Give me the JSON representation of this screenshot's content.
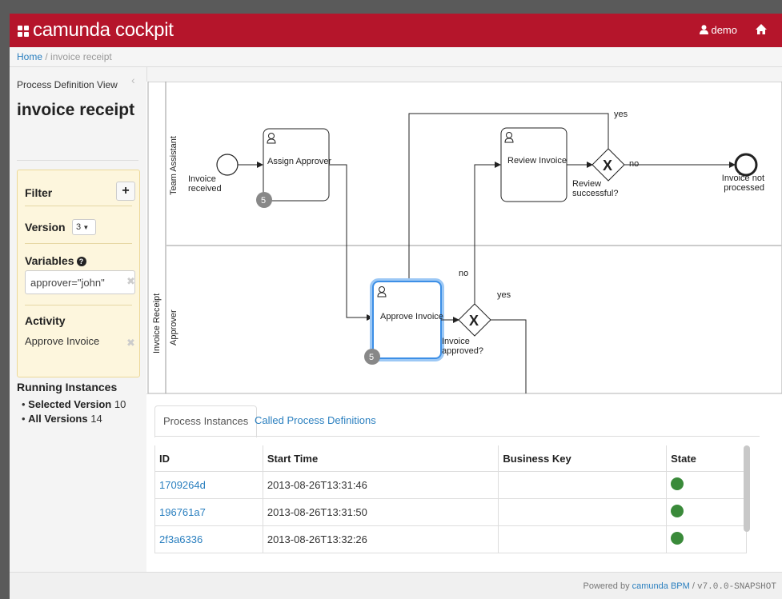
{
  "header": {
    "brand": "camunda cockpit",
    "user": "demo"
  },
  "breadcrumb": {
    "home": "Home",
    "current": "invoice receipt"
  },
  "sidebar": {
    "subtitle": "Process Definition View",
    "title": "invoice receipt",
    "filter": {
      "heading": "Filter",
      "version_label": "Version",
      "version_value": "3",
      "variables_label": "Variables",
      "variables_value": "approver=\"john\"",
      "activity_label": "Activity",
      "activity_value": "Approve Invoice"
    },
    "running": {
      "title": "Running Instances",
      "selected_label": "Selected Version",
      "selected_count": "10",
      "all_label": "All Versions",
      "all_count": "14"
    }
  },
  "diagram": {
    "pool": "Invoice Receipt",
    "lanes": [
      "Team Assistant",
      "Approver"
    ],
    "tasks": [
      {
        "label": "Assign Approver",
        "badge": "5"
      },
      {
        "label": "Review Invoice"
      },
      {
        "label": "Approve Invoice",
        "badge": "5"
      }
    ],
    "events": {
      "start": [
        "Invoice",
        "received"
      ],
      "end": [
        "Invoice not",
        "processed"
      ]
    },
    "gateways": {
      "review": [
        "Review",
        "successful?"
      ],
      "approve": [
        "Invoice",
        "approved?"
      ]
    },
    "flow_labels": {
      "yes_top": "yes",
      "no_review": "no",
      "no_approve": "no",
      "yes_approve": "yes"
    }
  },
  "tabs": [
    "Process Instances",
    "Called Process Definitions"
  ],
  "table": {
    "columns": [
      "ID",
      "Start Time",
      "Business Key",
      "State"
    ],
    "rows": [
      {
        "id": "1709264d",
        "start": "2013-08-26T13:31:46",
        "key": "",
        "state": "running"
      },
      {
        "id": "196761a7",
        "start": "2013-08-26T13:31:50",
        "key": "",
        "state": "running"
      },
      {
        "id": "2f3a6336",
        "start": "2013-08-26T13:32:26",
        "key": "",
        "state": "running"
      }
    ]
  },
  "footer": {
    "prefix": "Powered by",
    "link": "camunda BPM",
    "sep": " / ",
    "version": "v7.0.0-SNAPSHOT"
  },
  "colors": {
    "brand": "#b5152b",
    "link": "#2a7fbf",
    "state_ok": "#3a8a3a",
    "highlight": "#3d8fe6"
  }
}
